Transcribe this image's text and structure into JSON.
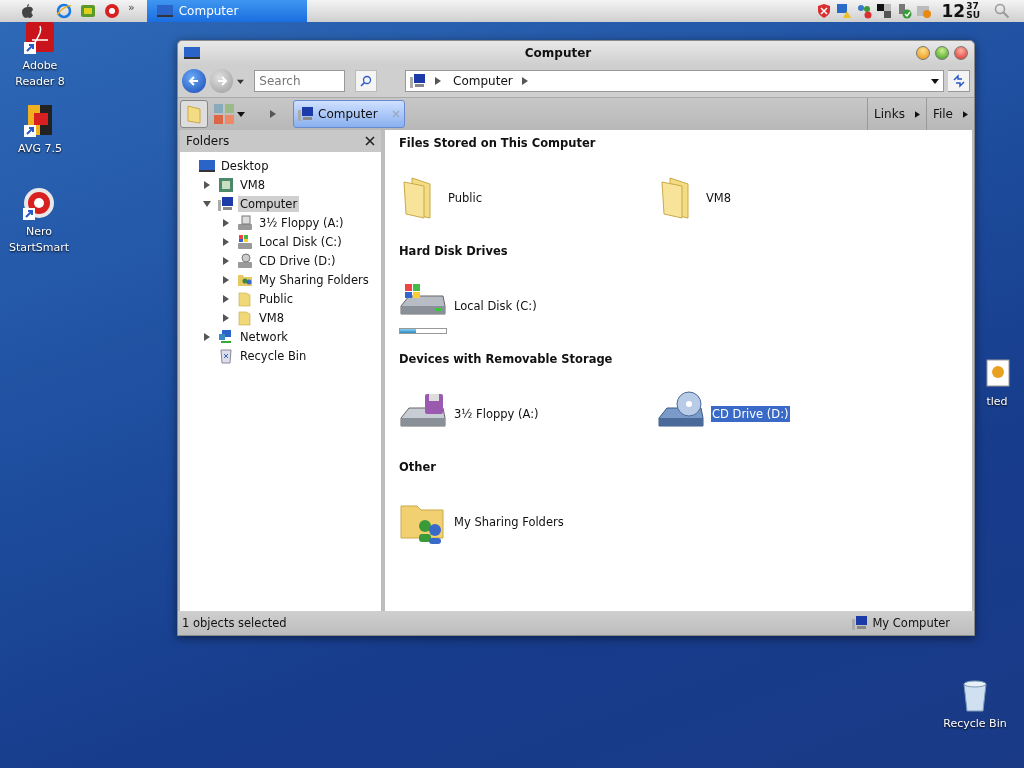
{
  "menubar": {
    "overflow": "»",
    "active_task": "Computer",
    "clock": {
      "hour": "12",
      "minute": "37",
      "day": "SU"
    }
  },
  "desktop_icons": [
    {
      "label": "Adobe Reader 8",
      "kind": "pdf"
    },
    {
      "label": "AVG 7.5",
      "kind": "avg"
    },
    {
      "label": "Nero StartSmart",
      "kind": "nero"
    },
    {
      "label": "tled",
      "kind": "image"
    },
    {
      "label": "Recycle Bin",
      "kind": "bin"
    }
  ],
  "window": {
    "title": "Computer",
    "search": {
      "placeholder": "Search"
    },
    "address": {
      "crumbs": [
        "Computer"
      ]
    },
    "tabs": [
      {
        "label": "Computer",
        "selected": true
      }
    ],
    "toolbar_menus": [
      "Links",
      "File"
    ],
    "folders_pane": {
      "title": "Folders",
      "tree": [
        {
          "label": "Desktop",
          "kind": "desktop",
          "selected": false,
          "children": [
            {
              "label": "VM8",
              "kind": "vm",
              "selected": false,
              "expanded": false
            },
            {
              "label": "Computer",
              "kind": "computer",
              "selected": true,
              "expanded": true,
              "children": [
                {
                  "label": "3½ Floppy (A:)",
                  "kind": "floppy",
                  "selected": false,
                  "expanded": false
                },
                {
                  "label": "Local Disk (C:)",
                  "kind": "disk",
                  "selected": false,
                  "expanded": false
                },
                {
                  "label": "CD Drive (D:)",
                  "kind": "cd",
                  "selected": false,
                  "expanded": false
                },
                {
                  "label": "My Sharing Folders",
                  "kind": "sharing",
                  "selected": false,
                  "expanded": false
                },
                {
                  "label": "Public",
                  "kind": "folder",
                  "selected": false,
                  "expanded": false
                },
                {
                  "label": "VM8",
                  "kind": "folder",
                  "selected": false,
                  "expanded": false
                }
              ]
            },
            {
              "label": "Network",
              "kind": "network",
              "selected": false,
              "expanded": false
            },
            {
              "label": "Recycle Bin",
              "kind": "recycle",
              "selected": false
            }
          ]
        }
      ]
    },
    "groups": [
      {
        "title": "Files Stored on This Computer",
        "items": [
          {
            "label": "Public",
            "kind": "folder",
            "selected": false
          },
          {
            "label": "VM8",
            "kind": "folder",
            "selected": false
          }
        ]
      },
      {
        "title": "Hard Disk Drives",
        "items": [
          {
            "label": "Local Disk (C:)",
            "kind": "disk",
            "selected": false,
            "level": 0.35
          }
        ]
      },
      {
        "title": "Devices with Removable Storage",
        "items": [
          {
            "label": "3½ Floppy (A:)",
            "kind": "floppy",
            "selected": false
          },
          {
            "label": "CD Drive (D:)",
            "kind": "cd",
            "selected": true
          }
        ]
      },
      {
        "title": "Other",
        "items": [
          {
            "label": "My Sharing Folders",
            "kind": "sharing",
            "selected": false
          }
        ]
      }
    ],
    "status_bar": {
      "left": "1 objects selected",
      "right": "My Computer"
    }
  }
}
